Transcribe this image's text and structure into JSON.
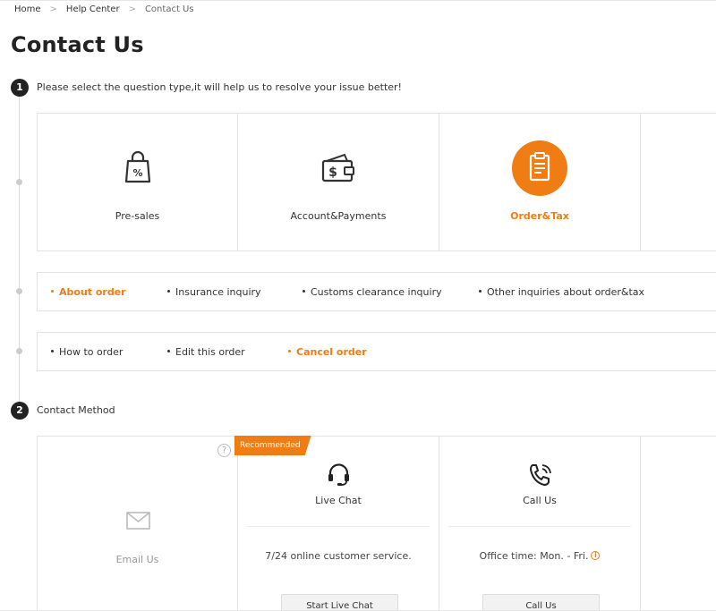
{
  "breadcrumb": {
    "home": "Home",
    "help_center": "Help Center",
    "current": "Contact Us",
    "separator": ">"
  },
  "page": {
    "title": "Contact Us"
  },
  "step1": {
    "number": "1",
    "text": "Please select the question type,it will help us to resolve your issue better!"
  },
  "categories": [
    {
      "label": "Pre-sales",
      "icon": "shopping-bag-percent-icon",
      "active": false
    },
    {
      "label": "Account&Payments",
      "icon": "wallet-dollar-icon",
      "active": false
    },
    {
      "label": "Order&Tax",
      "icon": "clipboard-icon",
      "active": true
    }
  ],
  "subtypes": [
    {
      "label": "About order",
      "active": true
    },
    {
      "label": "Insurance inquiry",
      "active": false
    },
    {
      "label": "Customs clearance inquiry",
      "active": false
    },
    {
      "label": "Other inquiries about order&tax",
      "active": false
    }
  ],
  "issues": [
    {
      "label": "How to order",
      "active": false
    },
    {
      "label": "Edit this order",
      "active": false
    },
    {
      "label": "Cancel order",
      "active": true
    }
  ],
  "step2": {
    "number": "2",
    "text": "Contact Method"
  },
  "methods": {
    "email": {
      "label": "Email Us",
      "icon": "envelope-icon",
      "help": "?"
    },
    "chat": {
      "badge": "Recommended",
      "title": "Live Chat",
      "icon": "headset-icon",
      "desc": "7/24 online customer service.",
      "button": "Start Live Chat"
    },
    "call": {
      "title": "Call Us",
      "icon": "phone-ringing-icon",
      "desc": "Office time: Mon. - Fri.",
      "info": "i",
      "button": "Call Us"
    }
  },
  "colors": {
    "accent": "#f07c14",
    "text": "#333333",
    "border": "#e3e3e3",
    "badge": "#222222"
  }
}
